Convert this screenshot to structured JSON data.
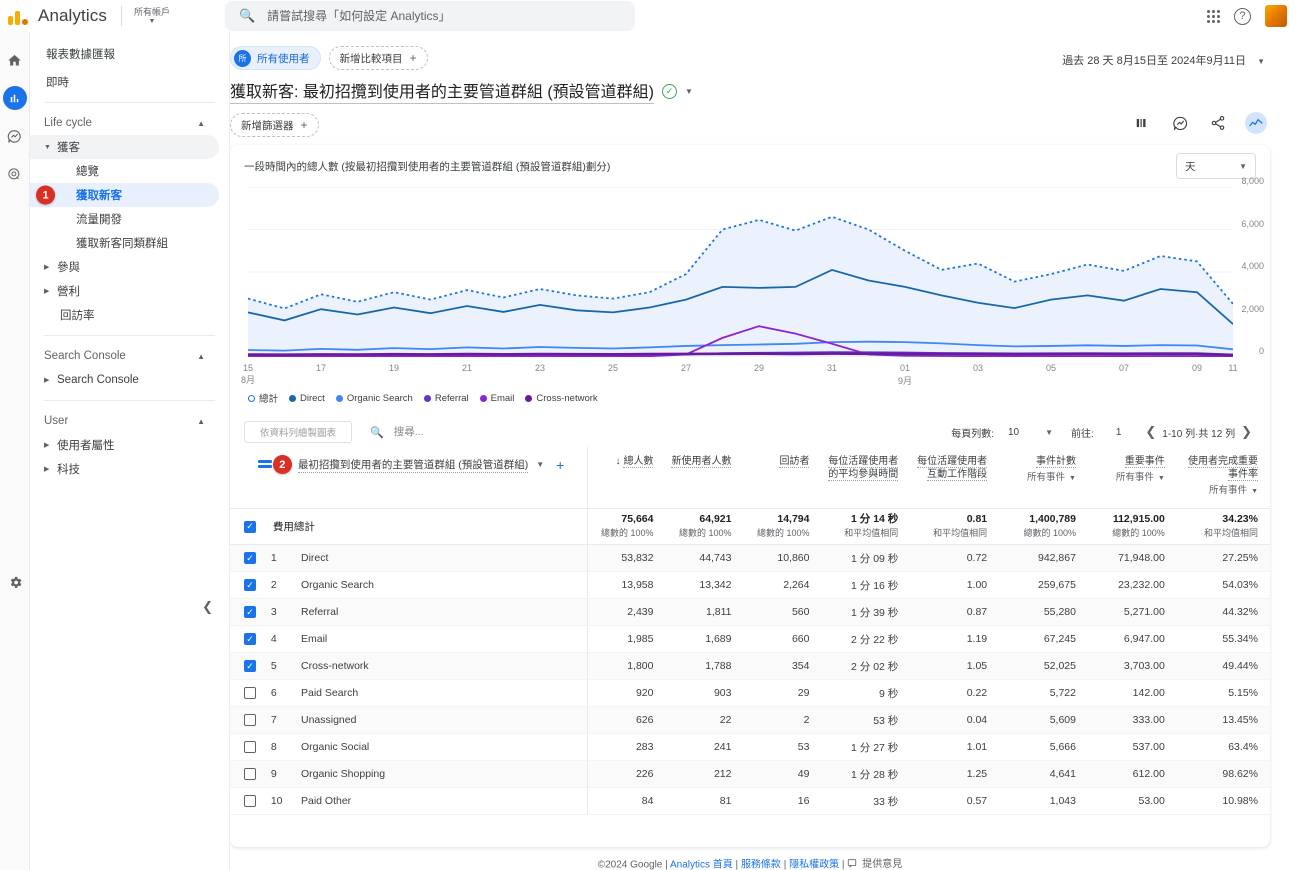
{
  "topbar": {
    "brand": "Analytics",
    "account_label": "所有帳戶",
    "search_placeholder": "請嘗試搜尋「如何設定 Analytics」",
    "help_glyph": "?"
  },
  "rail": {
    "items": [
      {
        "name": "home-icon",
        "label": "首頁"
      },
      {
        "name": "reports-icon",
        "label": "報表"
      },
      {
        "name": "explore-icon",
        "label": "探索"
      },
      {
        "name": "advertising-icon",
        "label": "廣告"
      }
    ],
    "settings_label": "管理"
  },
  "sidebar": {
    "top_items": [
      {
        "label": "報表數據匯報"
      },
      {
        "label": "即時"
      }
    ],
    "sections": [
      {
        "label": "Life cycle",
        "items": [
          {
            "label": "獲客",
            "type": "group",
            "expanded": true
          },
          {
            "label": "總覽",
            "type": "child"
          },
          {
            "label": "獲取新客",
            "type": "child",
            "selected": true,
            "badge": "1"
          },
          {
            "label": "流量開發",
            "type": "child"
          },
          {
            "label": "獲取新客同類群組",
            "type": "child"
          },
          {
            "label": "參與",
            "type": "group"
          },
          {
            "label": "營利",
            "type": "group"
          },
          {
            "label": "回訪率",
            "type": "plain"
          }
        ]
      },
      {
        "label": "Search Console",
        "items": [
          {
            "label": "Search Console",
            "type": "group"
          }
        ]
      },
      {
        "label": "User",
        "items": [
          {
            "label": "使用者屬性",
            "type": "group"
          },
          {
            "label": "科技",
            "type": "group"
          }
        ]
      }
    ]
  },
  "header": {
    "audience_chip": "所有使用者",
    "audience_avatar": "所",
    "add_comparison": "新增比較項目",
    "title": "獲取新客: 最初招攬到使用者的主要管道群組 (預設管道群組)",
    "add_filter": "新增篩選器",
    "date_range": "過去 28 天  8月15日至 2024年9月11日",
    "actions": [
      {
        "name": "compare-icon"
      },
      {
        "name": "insights-icon"
      },
      {
        "name": "share-icon"
      },
      {
        "name": "trend-icon",
        "active": true
      }
    ]
  },
  "chart": {
    "title": "一段時間內的總人數 (按最初招攬到使用者的主要管道群組 (預設管道群組)劃分)",
    "granularity": "天"
  },
  "chart_data": {
    "type": "line",
    "title": "一段時間內的總人數 (按最初招攬到使用者的主要管道群組 (預設管道群組)劃分)",
    "xlabel": "",
    "ylabel": "",
    "ylim": [
      0,
      8000
    ],
    "yticks": [
      0,
      2000,
      4000,
      6000,
      8000
    ],
    "ytick_labels": [
      "0",
      "2,000",
      "4,000",
      "6,000",
      "8,000"
    ],
    "grid": true,
    "legend_position": "bottom",
    "x": [
      "15",
      "16",
      "17",
      "18",
      "19",
      "20",
      "21",
      "22",
      "23",
      "24",
      "25",
      "26",
      "27",
      "28",
      "29",
      "30",
      "31",
      "01",
      "02",
      "03",
      "04",
      "05",
      "06",
      "07",
      "08",
      "09",
      "10",
      "11"
    ],
    "xtick_labels": [
      {
        "value": "15",
        "sub": "8月"
      },
      {
        "value": "17"
      },
      {
        "value": "19"
      },
      {
        "value": "21"
      },
      {
        "value": "23"
      },
      {
        "value": "25"
      },
      {
        "value": "27"
      },
      {
        "value": "29"
      },
      {
        "value": "31"
      },
      {
        "value": "01",
        "sub": "9月"
      },
      {
        "value": "03"
      },
      {
        "value": "05"
      },
      {
        "value": "07"
      },
      {
        "value": "09"
      },
      {
        "value": "11"
      }
    ],
    "series": [
      {
        "name": "總計",
        "color": "#1a73e8",
        "style": "dotted",
        "filled": true,
        "values": [
          2750,
          2280,
          2950,
          2600,
          3050,
          2700,
          3150,
          2800,
          3200,
          2900,
          2750,
          3050,
          3900,
          6000,
          6450,
          5950,
          6600,
          6000,
          5000,
          4100,
          4400,
          3550,
          3900,
          4350,
          4050,
          4750,
          4500,
          2500
        ]
      },
      {
        "name": "Direct",
        "color": "#1967a8",
        "style": "solid",
        "filled": false,
        "values": [
          2100,
          1720,
          2250,
          2000,
          2330,
          2060,
          2400,
          2120,
          2450,
          2200,
          2100,
          2330,
          2700,
          3300,
          3250,
          3300,
          4100,
          3600,
          3300,
          2900,
          2550,
          2300,
          2700,
          2900,
          2650,
          3200,
          3050,
          1550
        ]
      },
      {
        "name": "Organic Search",
        "color": "#4285f4",
        "style": "solid",
        "filled": false,
        "values": [
          330,
          300,
          380,
          340,
          420,
          370,
          450,
          400,
          470,
          430,
          400,
          450,
          520,
          560,
          590,
          620,
          700,
          720,
          700,
          640,
          560,
          500,
          520,
          550,
          520,
          560,
          540,
          360
        ]
      },
      {
        "name": "Referral",
        "color": "#5e35d1",
        "style": "solid",
        "filled": false,
        "values": [
          90,
          85,
          95,
          90,
          100,
          95,
          105,
          100,
          110,
          105,
          100,
          110,
          120,
          180,
          200,
          210,
          230,
          220,
          210,
          190,
          180,
          170,
          175,
          180,
          175,
          185,
          180,
          120
        ]
      },
      {
        "name": "Email",
        "color": "#8e24d0",
        "style": "solid",
        "filled": false,
        "values": [
          30,
          28,
          32,
          30,
          34,
          32,
          36,
          34,
          38,
          36,
          34,
          38,
          120,
          900,
          1450,
          1100,
          620,
          120,
          60,
          45,
          40,
          38,
          40,
          42,
          40,
          44,
          42,
          30
        ]
      },
      {
        "name": "Cross-network",
        "color": "#6a1b9a",
        "style": "solid",
        "filled": false,
        "values": [
          120,
          110,
          125,
          118,
          130,
          122,
          135,
          128,
          140,
          132,
          126,
          138,
          145,
          150,
          155,
          148,
          160,
          152,
          146,
          140,
          136,
          132,
          138,
          142,
          138,
          146,
          142,
          95
        ]
      }
    ]
  },
  "table_controls": {
    "chart_button": "依資料列繪製圖表",
    "search_placeholder": "搜尋...",
    "rows_per_page_label": "每頁列數:",
    "rows_per_page_value": "10",
    "goto_label": "前往:",
    "goto_value": "1",
    "range_label": "1-10 列·共 12 列"
  },
  "table": {
    "dimension_badge": "2",
    "dimension_header": "最初招攬到使用者的主要管道群組 (預設管道群組)",
    "metric_headers": [
      {
        "label": "總人數",
        "sorted": true,
        "sub": null
      },
      {
        "label": "新使用者人數",
        "sorted": false,
        "sub": null
      },
      {
        "label": "回訪者",
        "sorted": false,
        "sub": null
      },
      {
        "label": "每位活躍使用者的平均參與時間",
        "sorted": false,
        "sub": null
      },
      {
        "label": "每位活躍使用者互動工作階段",
        "sorted": false,
        "sub": null
      },
      {
        "label": "事件計數",
        "sorted": false,
        "sub": "所有事件"
      },
      {
        "label": "重要事件",
        "sorted": false,
        "sub": "所有事件"
      },
      {
        "label": "使用者完成重要事件率",
        "sorted": false,
        "sub": "所有事件"
      }
    ],
    "total_row": {
      "label": "費用總計",
      "values": [
        "75,664",
        "64,921",
        "14,794",
        "1 分 14 秒",
        "0.81",
        "1,400,789",
        "112,915.00",
        "34.23%"
      ],
      "subs": [
        "總數的 100%",
        "總數的 100%",
        "總數的 100%",
        "和平均值相同",
        "和平均值相同",
        "總數的 100%",
        "總數的 100%",
        "和平均值相同"
      ]
    },
    "rows": [
      {
        "checked": true,
        "index": "1",
        "name": "Direct",
        "values": [
          "53,832",
          "44,743",
          "10,860",
          "1 分 09 秒",
          "0.72",
          "942,867",
          "71,948.00",
          "27.25%"
        ]
      },
      {
        "checked": true,
        "index": "2",
        "name": "Organic Search",
        "values": [
          "13,958",
          "13,342",
          "2,264",
          "1 分 16 秒",
          "1.00",
          "259,675",
          "23,232.00",
          "54.03%"
        ]
      },
      {
        "checked": true,
        "index": "3",
        "name": "Referral",
        "values": [
          "2,439",
          "1,811",
          "560",
          "1 分 39 秒",
          "0.87",
          "55,280",
          "5,271.00",
          "44.32%"
        ]
      },
      {
        "checked": true,
        "index": "4",
        "name": "Email",
        "values": [
          "1,985",
          "1,689",
          "660",
          "2 分 22 秒",
          "1.19",
          "67,245",
          "6,947.00",
          "55.34%"
        ]
      },
      {
        "checked": true,
        "index": "5",
        "name": "Cross-network",
        "values": [
          "1,800",
          "1,788",
          "354",
          "2 分 02 秒",
          "1.05",
          "52,025",
          "3,703.00",
          "49.44%"
        ]
      },
      {
        "checked": false,
        "index": "6",
        "name": "Paid Search",
        "values": [
          "920",
          "903",
          "29",
          "9 秒",
          "0.22",
          "5,722",
          "142.00",
          "5.15%"
        ]
      },
      {
        "checked": false,
        "index": "7",
        "name": "Unassigned",
        "values": [
          "626",
          "22",
          "2",
          "53 秒",
          "0.04",
          "5,609",
          "333.00",
          "13.45%"
        ]
      },
      {
        "checked": false,
        "index": "8",
        "name": "Organic Social",
        "values": [
          "283",
          "241",
          "53",
          "1 分 27 秒",
          "1.01",
          "5,666",
          "537.00",
          "63.4%"
        ]
      },
      {
        "checked": false,
        "index": "9",
        "name": "Organic Shopping",
        "values": [
          "226",
          "212",
          "49",
          "1 分 28 秒",
          "1.25",
          "4,641",
          "612.00",
          "98.62%"
        ]
      },
      {
        "checked": false,
        "index": "10",
        "name": "Paid Other",
        "values": [
          "84",
          "81",
          "16",
          "33 秒",
          "0.57",
          "1,043",
          "53.00",
          "10.98%"
        ]
      }
    ]
  },
  "footer": {
    "copyright": "©2024 Google |",
    "links": [
      "Analytics 首頁",
      "服務條款",
      "隱私權政策"
    ],
    "feedback": "提供意見"
  }
}
